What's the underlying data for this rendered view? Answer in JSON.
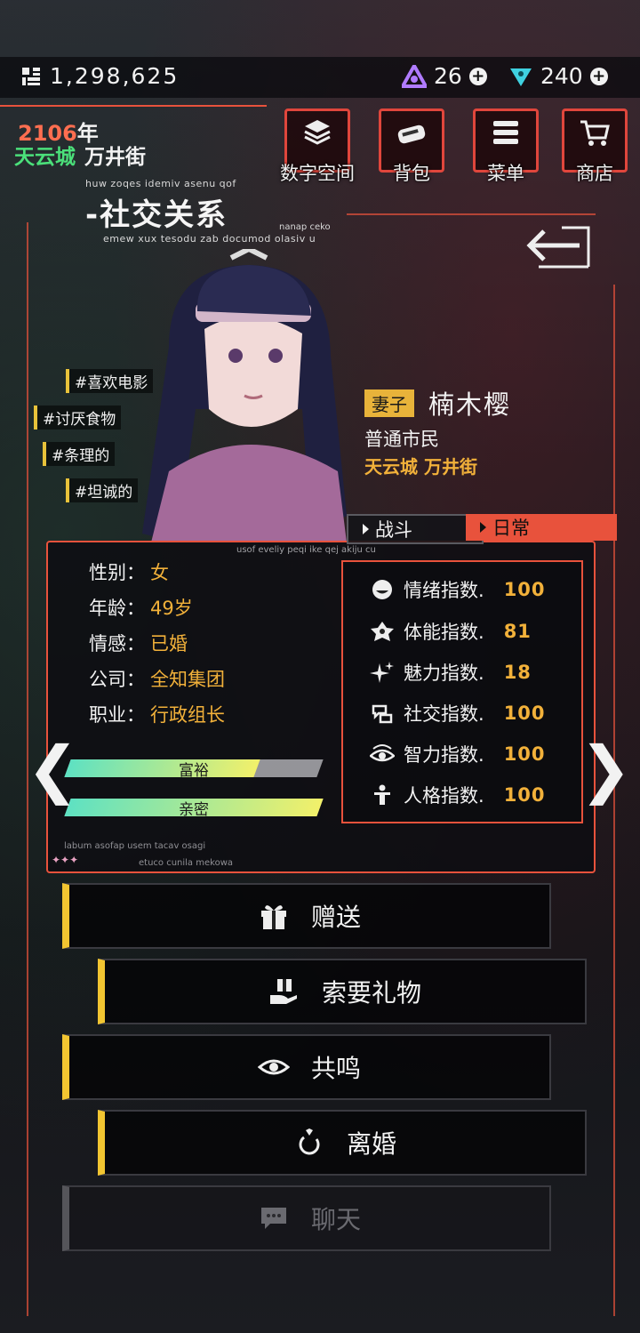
{
  "header": {
    "coins": "1,298,625",
    "resource_purple": "26",
    "resource_cyan": "240",
    "plus_symbol": "+"
  },
  "world": {
    "year_number": "2106",
    "year_unit": "年",
    "city": "天云城",
    "street": "万井街"
  },
  "top_buttons": [
    {
      "label": "数字空间",
      "icon": "layers-icon"
    },
    {
      "label": "背包",
      "icon": "bag-icon"
    },
    {
      "label": "菜单",
      "icon": "menu-icon"
    },
    {
      "label": "商店",
      "icon": "cart-icon"
    }
  ],
  "page": {
    "title": "-社交关系",
    "title_small": "huw zoqes idemiv asenu qof",
    "title_sub": "emew xux tesodu zab documod olasiv u",
    "title_tag": "nanap ceko"
  },
  "tags": [
    "#喜欢电影",
    "#讨厌食物",
    "#条理的",
    "#坦诚的"
  ],
  "character": {
    "role": "妻子",
    "name": "楠木樱",
    "status": "普通市民",
    "location": "天云城 万井街"
  },
  "tabs": {
    "battle": "战斗",
    "daily": "日常",
    "caption": "usof eveliy peqi ike qej akiju cu"
  },
  "info": [
    {
      "label": "性别：",
      "value": "女"
    },
    {
      "label": "年龄：",
      "value": "49岁"
    },
    {
      "label": "情感：",
      "value": "已婚"
    },
    {
      "label": "公司：",
      "value": "全知集团"
    },
    {
      "label": "职业：",
      "value": "行政组长"
    }
  ],
  "bars": [
    {
      "label": "富裕",
      "fill": 0.75
    },
    {
      "label": "亲密",
      "fill": 1.0
    }
  ],
  "stats": [
    {
      "label": "情绪指数.",
      "value": "100",
      "icon": "smile-icon"
    },
    {
      "label": "体能指数.",
      "value": "81",
      "icon": "stamina-icon"
    },
    {
      "label": "魅力指数.",
      "value": "18",
      "icon": "sparkle-icon"
    },
    {
      "label": "社交指数.",
      "value": "100",
      "icon": "social-icon"
    },
    {
      "label": "智力指数.",
      "value": "100",
      "icon": "eye-icon"
    },
    {
      "label": "人格指数.",
      "value": "100",
      "icon": "person-icon"
    }
  ],
  "panel_captions": {
    "line1": "labum asofap usem tacav osagi",
    "line2": "etuco cunila mekowa",
    "stars": "✦✦✦"
  },
  "nav": {
    "prev": "❮",
    "next": "❯"
  },
  "actions": [
    {
      "label": "赠送",
      "icon": "gift-icon",
      "enabled": true
    },
    {
      "label": "索要礼物",
      "icon": "receive-gift-icon",
      "enabled": true
    },
    {
      "label": "共鸣",
      "icon": "eye-icon",
      "enabled": true
    },
    {
      "label": "离婚",
      "icon": "broken-ring-icon",
      "enabled": true
    },
    {
      "label": "聊天",
      "icon": "chat-icon",
      "enabled": false
    }
  ],
  "colors": {
    "accent_red": "#e8523c",
    "gold": "#f2b13a",
    "green": "#4be07a",
    "button_stripe": "#f2c531"
  }
}
